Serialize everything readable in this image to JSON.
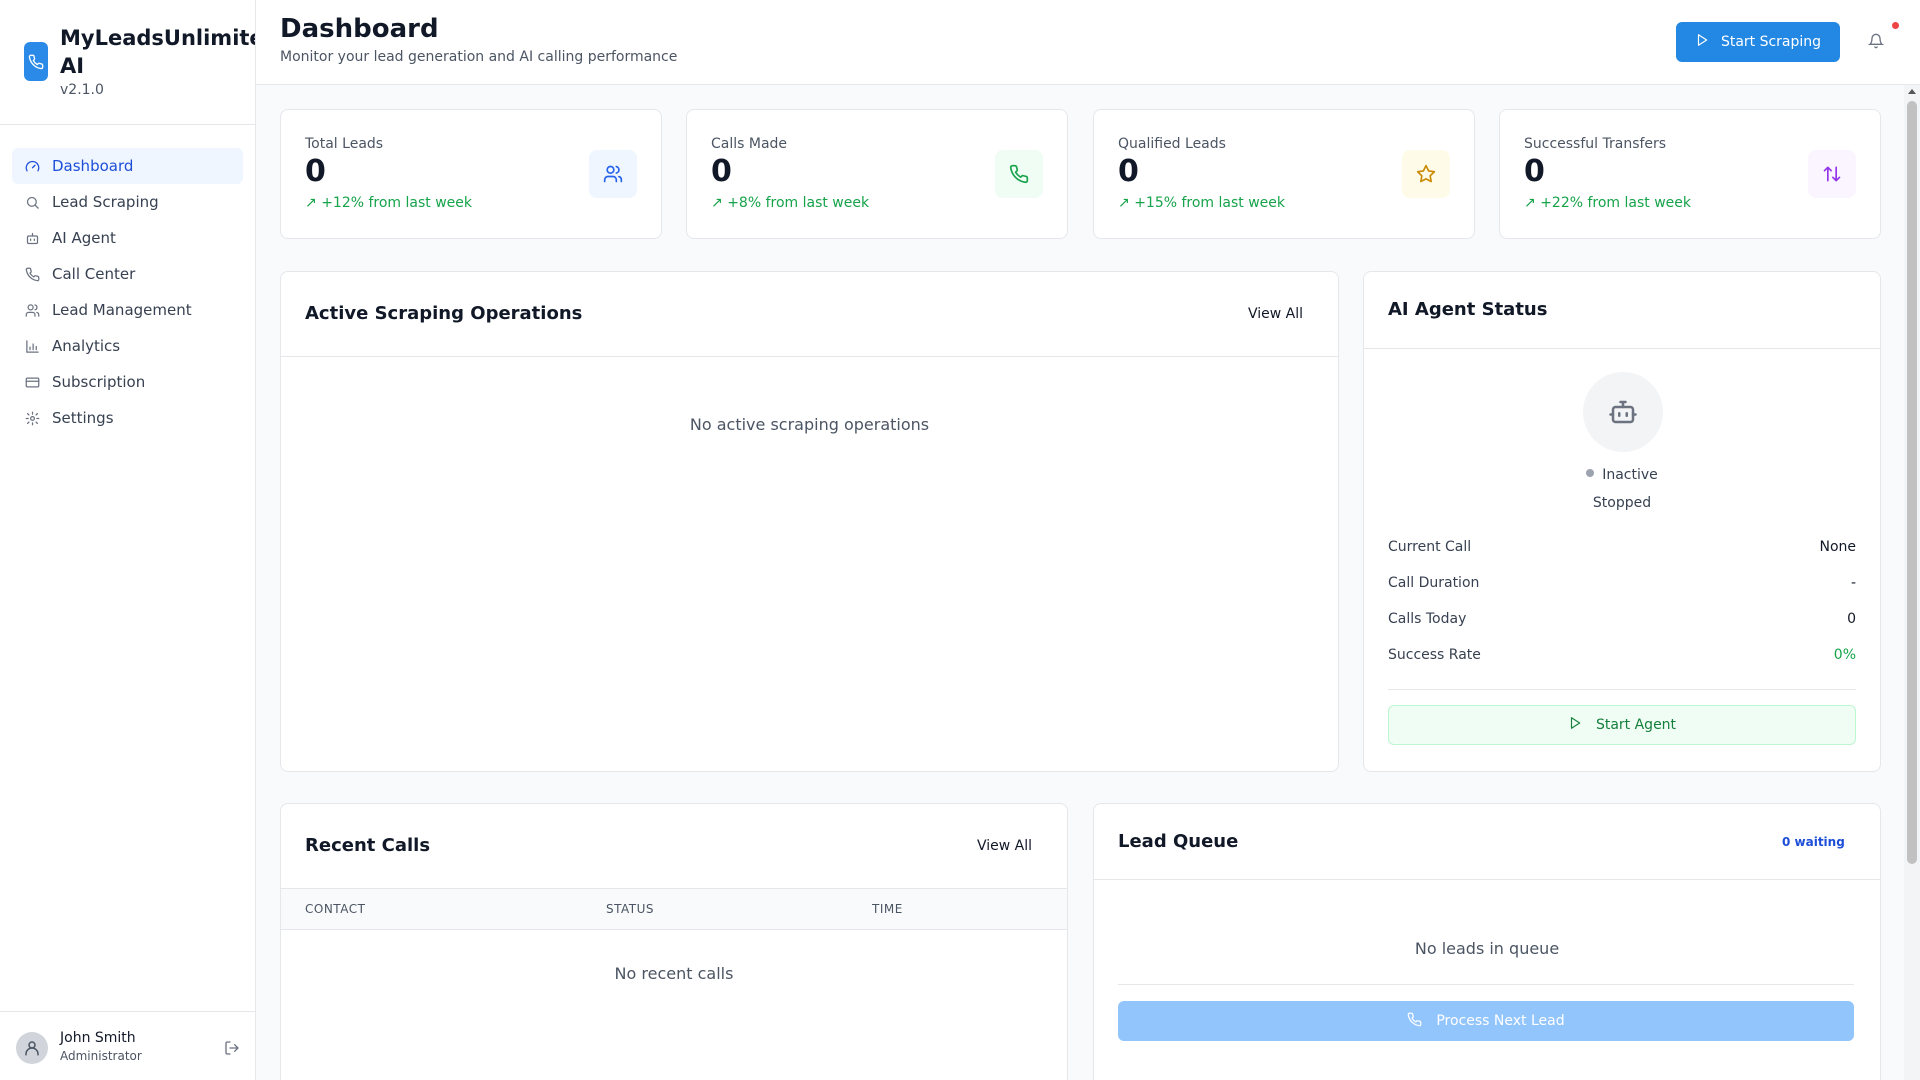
{
  "brand": {
    "name": "MyLeadsUnlimited AI",
    "version": "v2.1.0"
  },
  "sidebar": {
    "items": [
      {
        "label": "Dashboard",
        "icon": "gauge-icon",
        "active": true
      },
      {
        "label": "Lead Scraping",
        "icon": "search-icon"
      },
      {
        "label": "AI Agent",
        "icon": "bot-icon"
      },
      {
        "label": "Call Center",
        "icon": "phone-icon"
      },
      {
        "label": "Lead Management",
        "icon": "users-icon"
      },
      {
        "label": "Analytics",
        "icon": "bar-chart-icon"
      },
      {
        "label": "Subscription",
        "icon": "credit-card-icon"
      },
      {
        "label": "Settings",
        "icon": "gear-icon"
      }
    ]
  },
  "user": {
    "name": "John Smith",
    "role": "Administrator"
  },
  "header": {
    "title": "Dashboard",
    "subtitle": "Monitor your lead generation and AI calling performance",
    "start_scraping": "Start Scraping"
  },
  "stats": [
    {
      "label": "Total Leads",
      "value": "0",
      "change": "+12% from last week",
      "icon": "users-icon",
      "color": "#2563eb",
      "bg": "#eff6ff"
    },
    {
      "label": "Calls Made",
      "value": "0",
      "change": "+8% from last week",
      "icon": "phone-icon",
      "color": "#16a34a",
      "bg": "#f0fdf4"
    },
    {
      "label": "Qualified Leads",
      "value": "0",
      "change": "+15% from last week",
      "icon": "star-icon",
      "color": "#ca8a04",
      "bg": "#fefce8"
    },
    {
      "label": "Successful Transfers",
      "value": "0",
      "change": "+22% from last week",
      "icon": "transfer-icon",
      "color": "#9333ea",
      "bg": "#faf5ff"
    }
  ],
  "scraping": {
    "title": "Active Scraping Operations",
    "view_all": "View All",
    "empty": "No active scraping operations"
  },
  "agent": {
    "title": "AI Agent Status",
    "status": "Inactive",
    "substatus": "Stopped",
    "rows": [
      {
        "label": "Current Call",
        "value": "None"
      },
      {
        "label": "Call Duration",
        "value": "-"
      },
      {
        "label": "Calls Today",
        "value": "0"
      },
      {
        "label": "Success Rate",
        "value": "0%"
      }
    ],
    "start_button": "Start Agent"
  },
  "recent_calls": {
    "title": "Recent Calls",
    "view_all": "View All",
    "columns": [
      "CONTACT",
      "STATUS",
      "TIME"
    ],
    "empty": "No recent calls"
  },
  "lead_queue": {
    "title": "Lead Queue",
    "badge": "0 waiting",
    "empty": "No leads in queue",
    "button": "Process Next Lead"
  },
  "colors": {
    "primary": "#2388e3",
    "success": "#16a34a",
    "notification": "#ef4444"
  }
}
